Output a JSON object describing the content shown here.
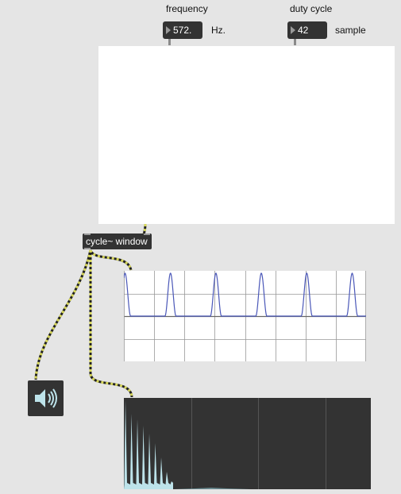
{
  "frequency": {
    "label": "frequency",
    "value": "572.",
    "unit": "Hz."
  },
  "duty_cycle": {
    "label": "duty cycle",
    "value": "42",
    "unit": "sample"
  },
  "object": {
    "label": "cycle~ window"
  },
  "speaker": {
    "icon": "speaker-icon"
  },
  "scope": {
    "trace_color": "#4a57b8",
    "peaks": 6
  },
  "colors": {
    "background": "#e5e5e5",
    "box": "#333333",
    "patchcord": "#d7d75a",
    "spectrum": "#bde3ea"
  }
}
